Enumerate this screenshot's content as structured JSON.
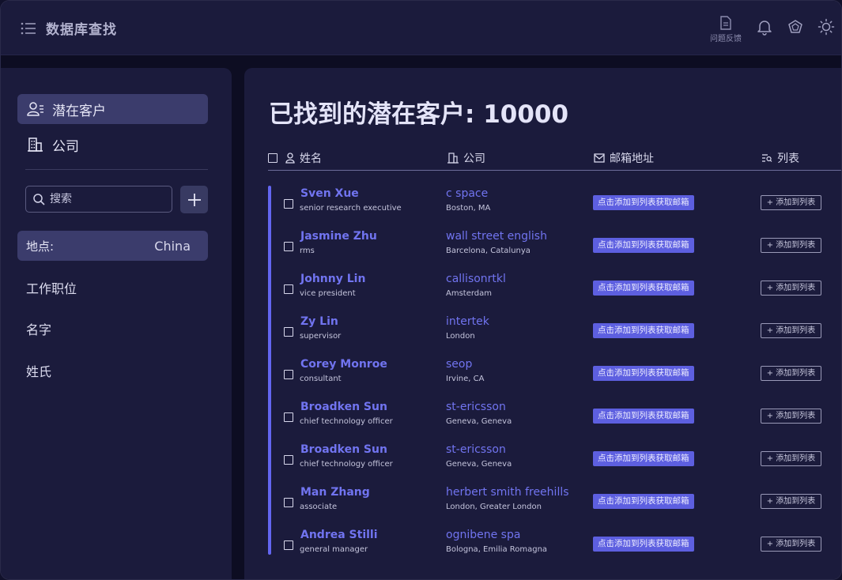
{
  "app": {
    "title": "数据库查找",
    "feedback_label": "问题反馈"
  },
  "sidebar": {
    "nav": [
      {
        "label": "潜在客户",
        "icon": "users-icon",
        "active": true
      },
      {
        "label": "公司",
        "icon": "building-icon",
        "active": false
      }
    ],
    "search_placeholder": "搜索",
    "location_filter": {
      "label": "地点:",
      "value": "China"
    },
    "filters": [
      "工作职位",
      "名字",
      "姓氏"
    ]
  },
  "main": {
    "title": "已找到的潜在客户: 10000",
    "columns": {
      "name": "姓名",
      "company": "公司",
      "email": "邮箱地址",
      "list": "列表"
    },
    "email_button_label": "点击添加到列表获取邮箱",
    "list_button_label": "添加到列表",
    "rows": [
      {
        "name": "Sven Xue",
        "title": "senior research executive",
        "company": "c space",
        "location": "Boston, MA"
      },
      {
        "name": "Jasmine Zhu",
        "title": "rms",
        "company": "wall street english",
        "location": "Barcelona, Catalunya"
      },
      {
        "name": "Johnny Lin",
        "title": "vice president",
        "company": "callisonrtkl",
        "location": "Amsterdam"
      },
      {
        "name": "Zy Lin",
        "title": "supervisor",
        "company": "intertek",
        "location": "London"
      },
      {
        "name": "Corey Monroe",
        "title": "consultant",
        "company": "seop",
        "location": "Irvine, CA"
      },
      {
        "name": "Broadken Sun",
        "title": "chief technology officer",
        "company": "st-ericsson",
        "location": "Geneva, Geneva"
      },
      {
        "name": "Broadken Sun",
        "title": "chief technology officer",
        "company": "st-ericsson",
        "location": "Geneva, Geneva"
      },
      {
        "name": "Man Zhang",
        "title": "associate",
        "company": "herbert smith freehills",
        "location": "London, Greater London"
      },
      {
        "name": "Andrea Stilli",
        "title": "general manager",
        "company": "ognibene spa",
        "location": "Bologna, Emilia Romagna"
      }
    ]
  },
  "colors": {
    "accent": "#6366f1",
    "link": "#7174f0",
    "panel": "#1b1b3c",
    "background": "#0d0d22"
  }
}
